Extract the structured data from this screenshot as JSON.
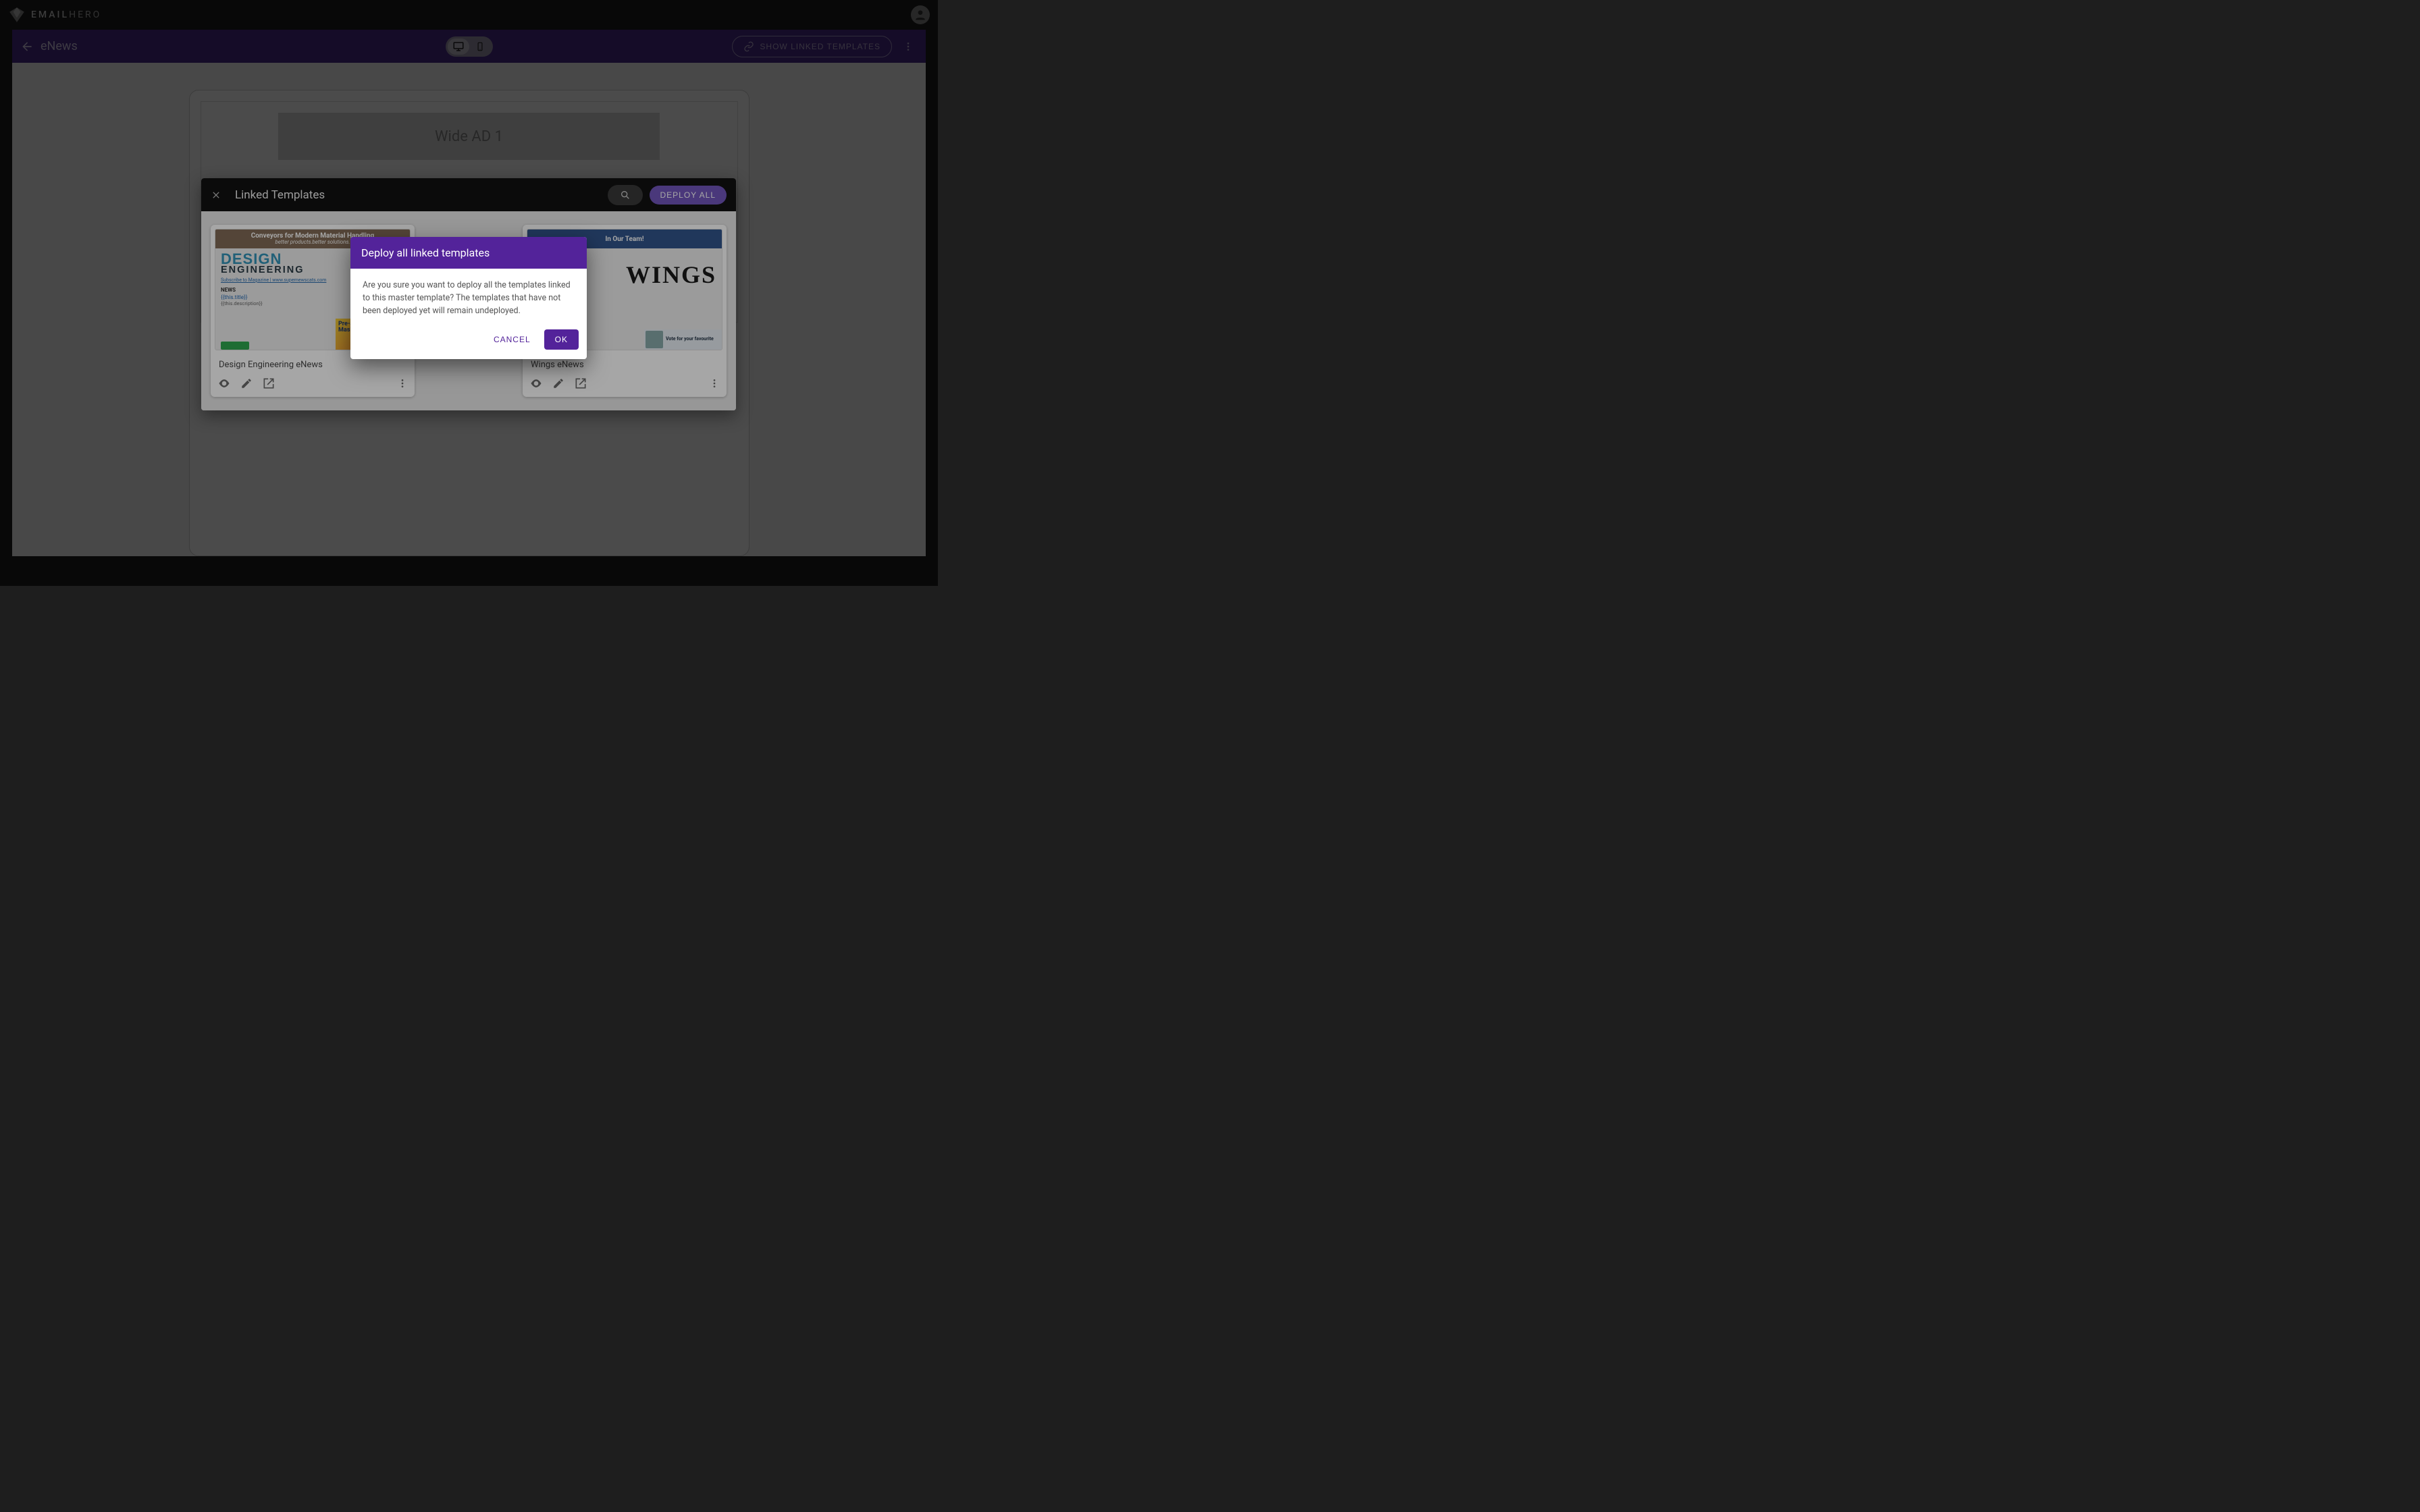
{
  "app": {
    "logo_text_bold": "EMAIL",
    "logo_text_light": "HERO"
  },
  "toolbar": {
    "page_title": "eNews",
    "show_linked_label": "SHOW LINKED TEMPLATES"
  },
  "canvas": {
    "ad_placeholder": "Wide AD 1"
  },
  "panel": {
    "title": "Linked Templates",
    "deploy_all_label": "DEPLOY ALL",
    "cards": [
      {
        "label": "Design Engineering eNews",
        "preview": {
          "banner_line1": "Conveyors for Modern Material Handling",
          "banner_line2": "better products.better solutions.",
          "logo_line1": "DESIGN",
          "logo_line2": "ENGINEERING",
          "link_text": "Subscribe to Magazine | www.supernewscats.com",
          "section": "NEWS",
          "tmpl_title": "{{this.title}}",
          "tmpl_desc": "{{this.description}}",
          "side_ad": "Pre-applied Thread Masking"
        }
      },
      {
        "label": "Wings eNews",
        "preview": {
          "banner_text": "In Our Team!",
          "logo": "WINGS",
          "ad_text": "Vote for your favourite"
        }
      }
    ]
  },
  "confirm": {
    "title": "Deploy all linked templates",
    "body": "Are you sure you want to deploy all the templates linked to this master template? The templates that have not been deployed yet will remain undeployed.",
    "cancel_label": "CANCEL",
    "ok_label": "OK"
  }
}
